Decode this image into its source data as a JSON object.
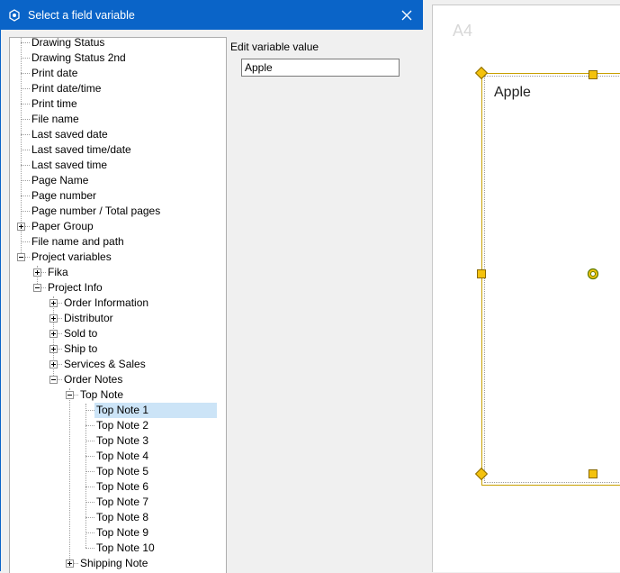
{
  "dialog": {
    "title": "Select a field variable"
  },
  "tree": {
    "items": [
      "Drawing  Status",
      "Drawing  Status  2nd",
      "Print date",
      "Print date/time",
      "Print time",
      "File name",
      "Last saved date",
      "Last saved time/date",
      "Last saved time",
      "Page Name",
      "Page number",
      "Page number / Total pages",
      "Paper Group",
      "File name and path",
      "Project variables",
      "Fika",
      "Project Info",
      "Order Information",
      "Distributor",
      "Sold to",
      "Ship to",
      "Services & Sales",
      "Order Notes",
      "Top Note",
      "Top Note 1",
      "Top Note 2",
      "Top Note 3",
      "Top Note 4",
      "Top Note 5",
      "Top Note 6",
      "Top Note 7",
      "Top Note 8",
      "Top Note 9",
      "Top Note 10",
      "Shipping Note"
    ],
    "selected_index": 24
  },
  "edit": {
    "label": "Edit variable value",
    "value": "Apple"
  },
  "canvas": {
    "sheet_name": "A4",
    "textbox_text": "Apple"
  },
  "colors": {
    "titlebar": "#0a64c8",
    "selection": "#cce4f7",
    "handle": "#f4c20d"
  },
  "icons": [
    "app-icon",
    "close-icon",
    "plus-expander-icon",
    "minus-expander-icon"
  ]
}
